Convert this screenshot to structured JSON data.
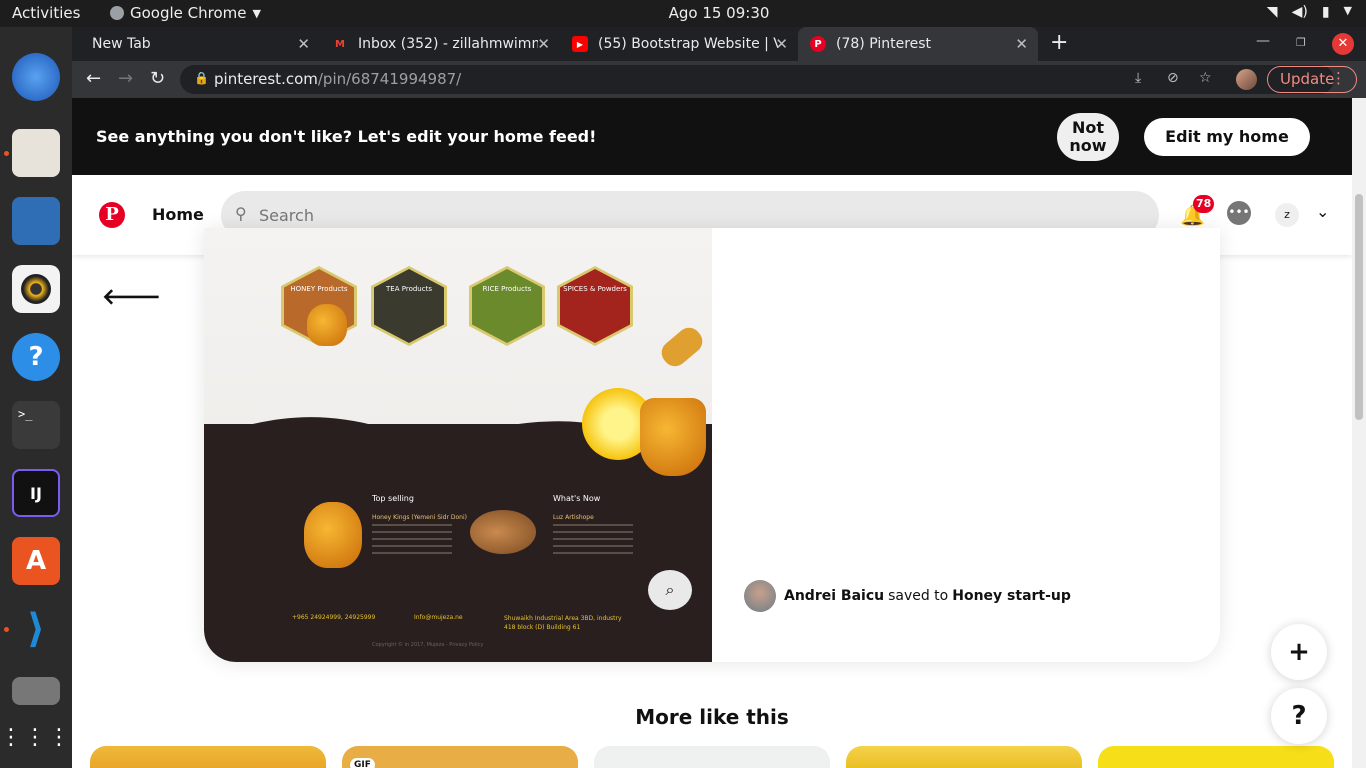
{
  "os": {
    "activities": "Activities",
    "app_name": "Google Chrome",
    "clock": "Ago 15  09:30"
  },
  "browser": {
    "tabs": [
      {
        "title": "New Tab"
      },
      {
        "title": "Inbox (352) - zillahmwimm"
      },
      {
        "title": "(55) Bootstrap Website | V"
      },
      {
        "title": "(78) Pinterest"
      }
    ],
    "new_tab": "+",
    "url_host": "pinterest.com",
    "url_path": "/pin/68741994987/",
    "update_label": "Update"
  },
  "banner": {
    "message": "See anything you don't like? Let's edit your home feed!",
    "not_now": "Not now",
    "edit_feed": "Edit my home feed"
  },
  "header": {
    "home": "Home",
    "search_placeholder": "Search",
    "notification_count": "78",
    "avatar_initial": "z"
  },
  "pin": {
    "hexagons": [
      {
        "label": "HONEY Products",
        "color": "#b9692a"
      },
      {
        "label": "TEA Products",
        "color": "#3b3a2e"
      },
      {
        "label": "RICE Products",
        "color": "#6b8a2b"
      },
      {
        "label": "SPICES & Powders",
        "color": "#a3241c"
      }
    ],
    "col1_title": "Top selling",
    "col1_sub": "Honey Kings (Yemeni Sidr Doni)",
    "col2_title": "What's Now",
    "col2_sub": "Luz Artishope",
    "phone": "+965 24924999, 24925999",
    "email": "Info@mujeza.ne",
    "address": "Shuwaikh Industrial Area 3BD, industry 418 block (D) Building 61",
    "copyright": "Copyright © in 2017, Mujeza - Privacy Policy",
    "saver_name": "Andrei Baicu",
    "saved_to": "saved to",
    "board": "Honey start-up"
  },
  "more_like_this": "More like this",
  "gif_badge": "GIF",
  "fab_plus": "+",
  "fab_help": "?",
  "colors": {
    "pinterest_red": "#e60023",
    "chrome_dark": "#35363a",
    "update_red": "#f28b82"
  }
}
